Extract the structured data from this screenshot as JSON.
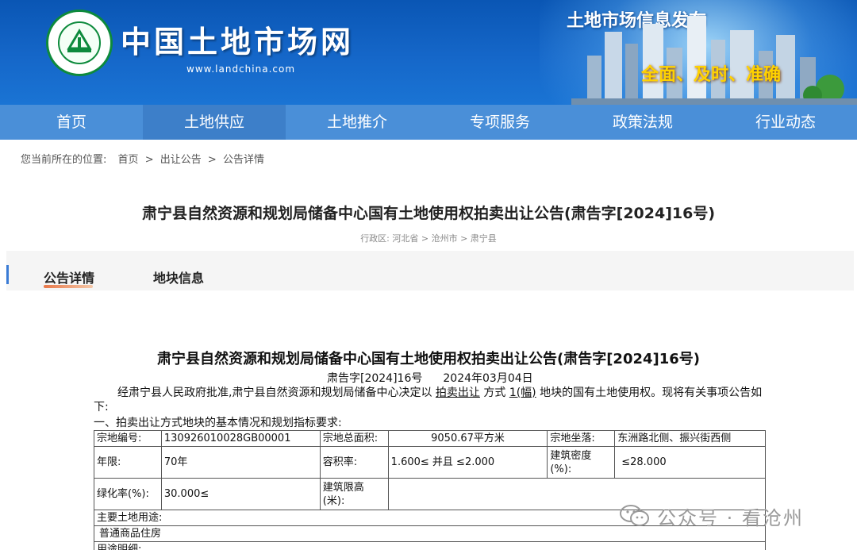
{
  "header": {
    "site_name": "中国土地市场网",
    "url": "www.landchina.com",
    "slogan_top": "土地市场信息发布",
    "slogan_bottom": "全面、及时、准确",
    "logo_text": "中国土地市场网 WWW.LANDCHINA.COM"
  },
  "nav": {
    "items": [
      "首页",
      "土地供应",
      "土地推介",
      "专项服务",
      "政策法规",
      "行业动态"
    ],
    "active_index": 1
  },
  "breadcrumb": {
    "label": "您当前所在的位置:",
    "items": [
      "首页",
      ">",
      "出让公告",
      ">",
      "公告详情"
    ]
  },
  "page_title": "肃宁县自然资源和规划局储备中心国有土地使用权拍卖出让公告(肃告字[2024]16号)",
  "region": "行政区: 河北省 > 沧州市 > 肃宁县",
  "tabs": {
    "items": [
      "公告详情",
      "地块信息"
    ],
    "active_index": 0
  },
  "announcement": {
    "title": "肃宁县自然资源和规划局储备中心国有土地使用权拍卖出让公告(肃告字[2024]16号)",
    "doc_no": "肃告字[2024]16号",
    "date": "2024年03月04日",
    "p1_a": "经肃宁县人民政府批准,肃宁县自然资源和规划局储备中心决定以 ",
    "p1_method": "拍卖出让",
    "p1_b": " 方式 ",
    "p1_count": "1(幅)",
    "p1_c": " 地块的国有土地使用权。现将有关事项公告如下:",
    "p2": "一、拍卖出让方式地块的基本情况和规划指标要求:"
  },
  "table": {
    "r1": [
      "宗地编号:",
      "130926010028GB00001",
      "宗地总面积:",
      "9050.67平方米",
      "宗地坐落:",
      "东洲路北侧、振兴街西侧"
    ],
    "r2": [
      "年限:",
      "70年",
      "容积率:",
      "1.600≤ 并且 ≤2.000",
      "建筑密度(%):",
      "≤28.000"
    ],
    "r3": [
      "绿化率(%):",
      "30.000≤",
      "建筑限高(米):",
      ""
    ],
    "r4": "主要土地用途:",
    "r5": "普通商品住房",
    "r6": "用途明细:"
  },
  "watermark": "公众号 · 看沧州",
  "colors": {
    "banner": "#1567c9",
    "nav": "#4a8fd8",
    "nav_active": "#3d7fc9",
    "slogan_yellow": "#ffd200",
    "logo_green": "#0d8a3c"
  }
}
